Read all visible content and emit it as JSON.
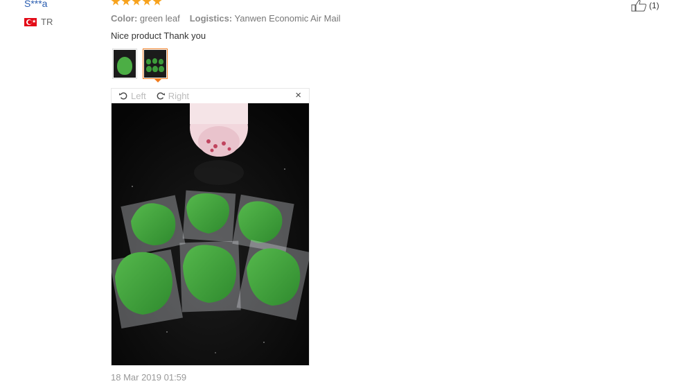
{
  "reviewer": {
    "name": "S***a",
    "country_code": "TR"
  },
  "rating": {
    "stars": 5
  },
  "meta": {
    "color_label": "Color:",
    "color_value": "green leaf",
    "logistics_label": "Logistics:",
    "logistics_value": "Yanwen Economic Air Mail"
  },
  "review": {
    "text": "Nice product Thank you",
    "date": "18 Mar 2019 01:59"
  },
  "viewer": {
    "rotate_left_label": "Left",
    "rotate_right_label": "Right",
    "close_symbol": "×"
  },
  "helpful": {
    "count": "(1)"
  },
  "colors": {
    "star": "#f7a21c",
    "link": "#2a5db0",
    "active_border": "#f07a1c",
    "leaf": "#3d9d3a"
  },
  "icons": [
    "turkey-flag-icon",
    "star-icon",
    "rotate-left-icon",
    "rotate-right-icon",
    "close-icon",
    "thumbs-up-icon"
  ]
}
